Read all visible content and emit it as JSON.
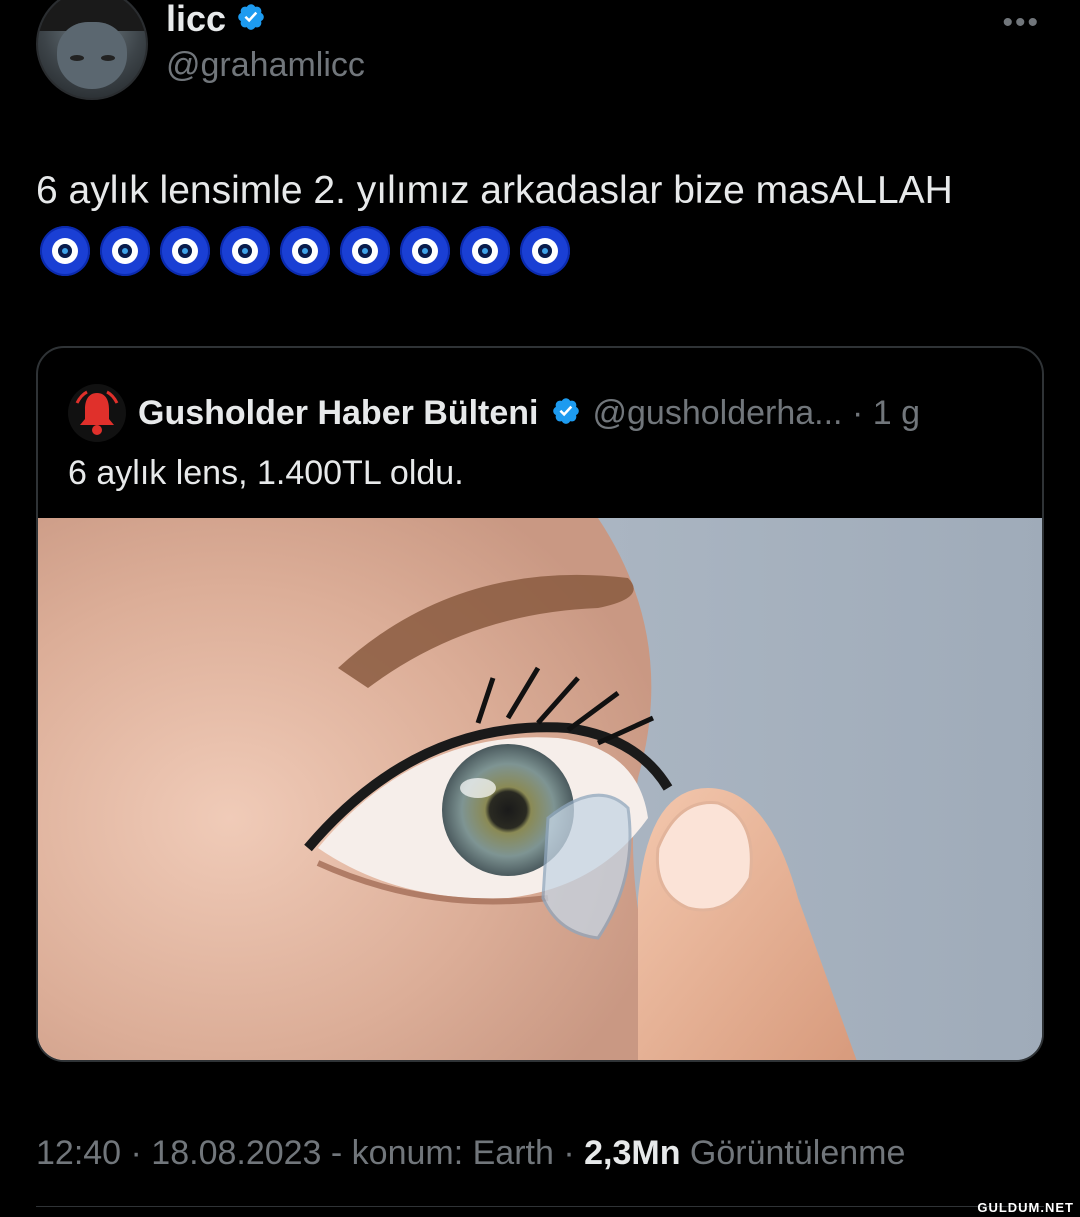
{
  "author": {
    "name": "licc",
    "handle": "@grahamlicc",
    "verified": true
  },
  "more_label": "•••",
  "tweet": {
    "text": "6 aylık lensimle 2. yılımız arkadaslar bize masALLAH",
    "emoji_count": 9,
    "emoji_icon": "nazar-evil-eye-icon"
  },
  "quoted": {
    "name": "Gusholder Haber Bülteni",
    "handle_time": "@gusholderha... · 1 g",
    "text": "6 aylık lens, 1.400TL oldu.",
    "avatar_icon": "bell-icon",
    "image_alt": "contact lens on fingertip near eye"
  },
  "footer": {
    "meta": "12:40 · 18.08.2023 - konum: Earth · ",
    "views_count": "2,3Mn",
    "views_label": " Görüntülenme"
  },
  "watermark": "GULDUM.NET",
  "colors": {
    "background": "#000000",
    "verified": "#1d9bf0",
    "muted": "#71767b",
    "text": "#e7e9ea"
  }
}
